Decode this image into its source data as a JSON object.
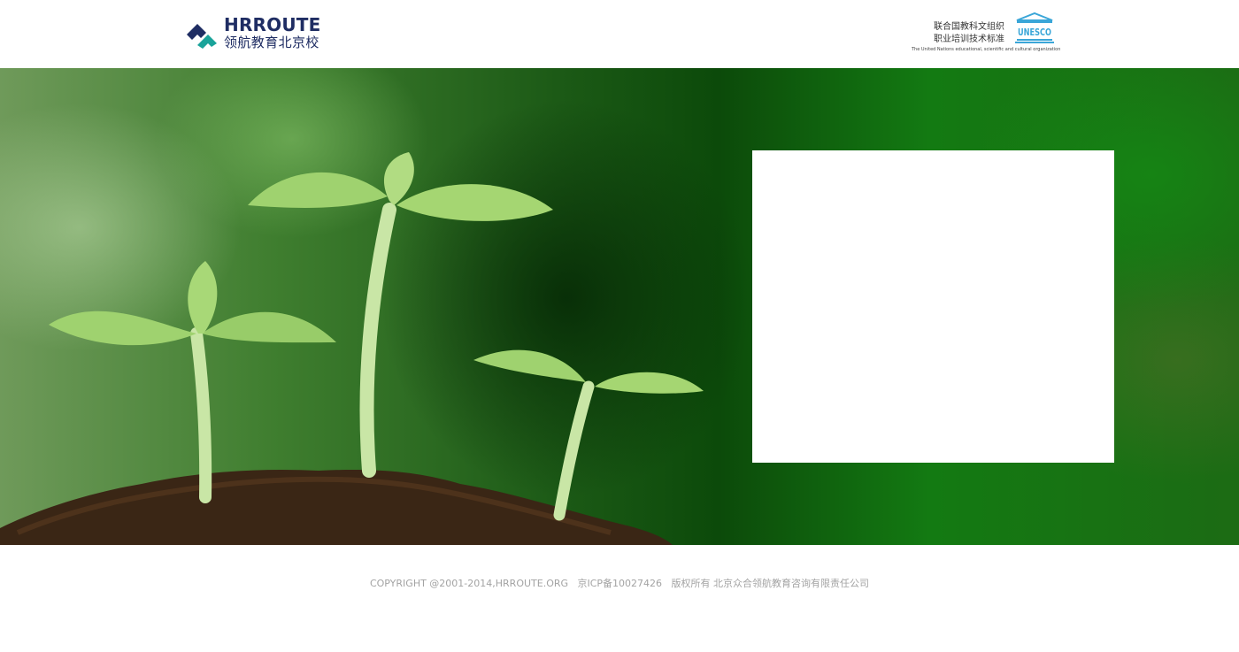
{
  "header": {
    "brand_en": "HRROUTE",
    "brand_cn": "领航教育北京校",
    "unesco_cn_line1": "联合国教科文组织",
    "unesco_cn_line2": "职业培训技术标准",
    "unesco_en": "The United Nations educational, scientific and cultural organization",
    "unesco_word": "UNESCO"
  },
  "footer": {
    "copyright": "COPYRIGHT @2001-2014,HRROUTE.ORG   京ICP备10027426   版权所有 北京众合领航教育咨询有限责任公司"
  },
  "colors": {
    "brand_navy": "#1f2d63",
    "brand_teal": "#1aa39a",
    "unesco_blue": "#3aa6d8",
    "footer_text": "#a3a3a3",
    "banner_green": "#137a12"
  }
}
